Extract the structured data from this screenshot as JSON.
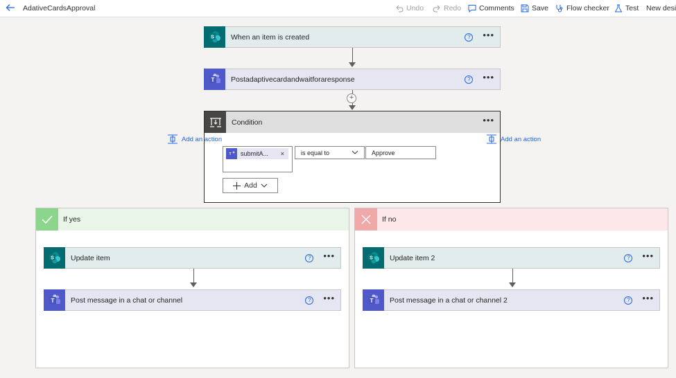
{
  "header": {
    "title": "AdativeCardsApproval",
    "undo": "Undo",
    "redo": "Redo",
    "comments": "Comments",
    "save": "Save",
    "flow_checker": "Flow checker",
    "test": "Test",
    "new_designer": "New desig"
  },
  "trigger": {
    "label": "When an item is created"
  },
  "teams_action": {
    "label": "Postadaptivecardandwaitforaresponse"
  },
  "condition": {
    "label": "Condition",
    "token_label": "submitA...",
    "token_remove": "×",
    "operator": "is equal to",
    "value": "Approve",
    "add_label": "Add"
  },
  "branch_yes": {
    "label": "If yes",
    "actions": [
      {
        "label": "Update item"
      },
      {
        "label": "Post message in a chat or channel"
      }
    ],
    "add_action": "Add an action"
  },
  "branch_no": {
    "label": "If no",
    "actions": [
      {
        "label": "Update item 2"
      },
      {
        "label": "Post message in a chat or channel 2"
      }
    ],
    "add_action": "Add an action"
  },
  "symbols": {
    "help": "?",
    "more": "•••",
    "plus": "+"
  },
  "colors": {
    "sharepoint": "#036c70",
    "teams": "#5059c9",
    "yes": "#8cd58c",
    "no": "#f1a8a8",
    "link": "#2266e3"
  }
}
